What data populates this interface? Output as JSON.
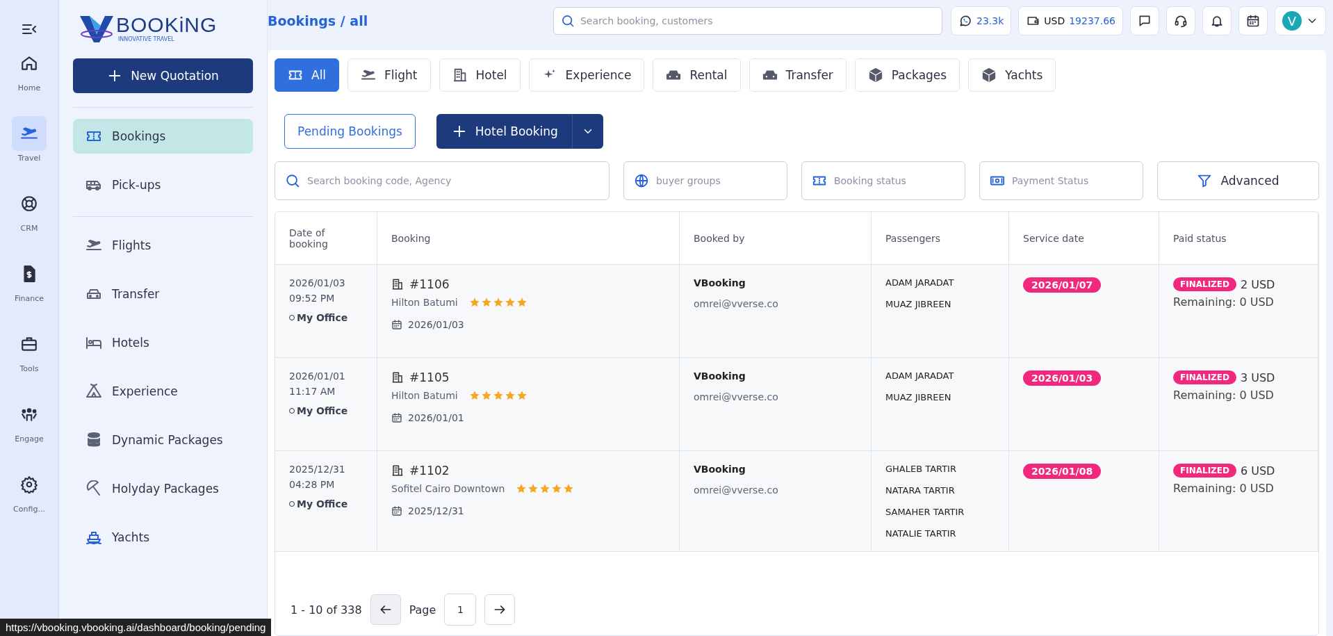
{
  "rail": {
    "items": [
      {
        "label": "Home",
        "selected": false
      },
      {
        "label": "Travel",
        "selected": true
      },
      {
        "label": "CRM",
        "selected": false
      },
      {
        "label": "Finance",
        "selected": false
      },
      {
        "label": "Tools",
        "selected": false
      },
      {
        "label": "Engage",
        "selected": false
      },
      {
        "label": "Config...",
        "selected": false
      }
    ]
  },
  "logo": {
    "name": "BOOKiNG",
    "tagline": "INNOVATIVE TRAVEL"
  },
  "new_button": "New Quotation",
  "sidebar": {
    "top_items": [
      {
        "label": "Bookings",
        "selected": true
      },
      {
        "label": "Pick-ups",
        "selected": false
      }
    ],
    "items": [
      {
        "label": "Flights",
        "selected": false
      },
      {
        "label": "Transfer",
        "selected": false
      },
      {
        "label": "Hotels",
        "selected": false
      },
      {
        "label": "Experience",
        "selected": false
      },
      {
        "label": "Dynamic Packages",
        "selected": false
      },
      {
        "label": "Holyday Packages",
        "selected": false
      },
      {
        "label": "Yachts",
        "selected": false
      }
    ]
  },
  "header": {
    "breadcrumb": "Bookings / all",
    "search": {
      "placeholder": "Search booking, customers"
    },
    "whatsapp": "23.3k",
    "currency": "USD",
    "balance": "19237.66",
    "avatar": "V"
  },
  "tabs": [
    {
      "label": "All",
      "selected": true
    },
    {
      "label": "Flight",
      "selected": false
    },
    {
      "label": "Hotel",
      "selected": false
    },
    {
      "label": "Experience",
      "selected": false
    },
    {
      "label": "Rental",
      "selected": false
    },
    {
      "label": "Transfer",
      "selected": false
    },
    {
      "label": "Packages",
      "selected": false
    },
    {
      "label": "Yachts",
      "selected": false
    }
  ],
  "actions": {
    "pending": "Pending Bookings",
    "create": "Hotel Booking"
  },
  "filters": {
    "search": {
      "placeholder": "Search booking code, Agency"
    },
    "buyer_groups": {
      "placeholder": "buyer groups"
    },
    "booking_status": {
      "placeholder": "Booking status"
    },
    "payment_status": {
      "placeholder": "Payment Status"
    },
    "advanced": "Advanced"
  },
  "table": {
    "columns": [
      "Date of booking",
      "Booking",
      "Booked by",
      "Passengers",
      "Service date",
      "Paid status"
    ],
    "rows": [
      {
        "date": "2026/01/03",
        "time": "09:52 PM",
        "office": "My Office",
        "code": "#1106",
        "hotel": "Hilton Batumi",
        "stars": 5,
        "booking_date": "2026/01/03",
        "booked_by": "VBooking",
        "email": "omrei@vverse.co",
        "passengers": [
          "ADAM JARADAT",
          "MUAZ JIBREEN"
        ],
        "service_date": "2026/01/07",
        "status": "FINALIZED",
        "amount": "2 USD",
        "remaining": "Remaining: 0 USD"
      },
      {
        "date": "2026/01/01",
        "time": "11:17 AM",
        "office": "My Office",
        "code": "#1105",
        "hotel": "Hilton Batumi",
        "stars": 5,
        "booking_date": "2026/01/01",
        "booked_by": "VBooking",
        "email": "omrei@vverse.co",
        "passengers": [
          "ADAM JARADAT",
          "MUAZ JIBREEN"
        ],
        "service_date": "2026/01/03",
        "status": "FINALIZED",
        "amount": "3 USD",
        "remaining": "Remaining: 0 USD"
      },
      {
        "date": "2025/12/31",
        "time": "04:28 PM",
        "office": "My Office",
        "code": "#1102",
        "hotel": "Sofitel Cairo Downtown",
        "stars": 5,
        "booking_date": "2025/12/31",
        "booked_by": "VBooking",
        "email": "omrei@vverse.co",
        "passengers": [
          "GHALEB TARTIR",
          "NATARA TARTIR",
          "SAMAHER TARTIR",
          "NATALIE TARTIR"
        ],
        "service_date": "2026/01/08",
        "status": "FINALIZED",
        "amount": "6 USD",
        "remaining": "Remaining: 0 USD"
      }
    ]
  },
  "pagination": {
    "range": "1 - 10 of 338",
    "label": "Page",
    "page": "1"
  },
  "status_bar": {
    "url": "https://vbooking.vbooking.ai/dashboard/booking/pending"
  }
}
